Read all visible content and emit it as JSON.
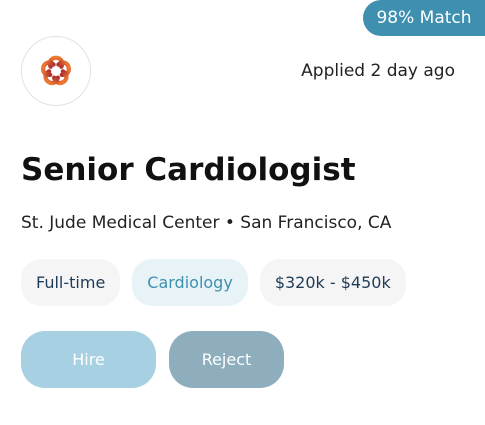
{
  "match_badge": "98% Match",
  "logo": {
    "icon": "org-logo-icon",
    "colors": [
      "#e26a2c",
      "#b5332e"
    ]
  },
  "applied": "Applied 2 day ago",
  "job": {
    "title": "Senior Cardiologist",
    "organization": "St. Jude Medical Center • San Francisco, CA"
  },
  "tags": [
    {
      "label": "Full-time"
    },
    {
      "label": "Cardiology"
    },
    {
      "label": "$320k - $450k"
    }
  ],
  "actions": {
    "hire_label": "Hire",
    "reject_label": "Reject"
  },
  "colors": {
    "accent": "#3e8fb0",
    "hire_button": "#a7d0e2",
    "reject_button": "#8eadbd"
  }
}
